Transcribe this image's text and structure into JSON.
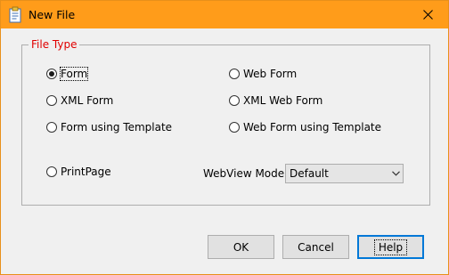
{
  "window": {
    "title": "New File",
    "accent_color": "#ff9c1a"
  },
  "group": {
    "legend": "File Type",
    "legend_color": "#e00000"
  },
  "radios": {
    "form": {
      "label": "Form",
      "checked": true
    },
    "web_form": {
      "label": "Web Form",
      "checked": false
    },
    "xml_form": {
      "label": "XML Form",
      "checked": false
    },
    "xml_web_form": {
      "label": "XML Web Form",
      "checked": false
    },
    "form_template": {
      "label": "Form using Template",
      "checked": false
    },
    "web_form_template": {
      "label": "Web Form using Template",
      "checked": false
    },
    "printpage": {
      "label": "PrintPage",
      "checked": false
    }
  },
  "webview": {
    "label": "WebView Mode:",
    "selected": "Default"
  },
  "buttons": {
    "ok": "OK",
    "cancel": "Cancel",
    "help": "Help"
  },
  "icons": {
    "title": "document-new-icon",
    "close": "close-icon",
    "dropdown": "chevron-down-icon"
  }
}
